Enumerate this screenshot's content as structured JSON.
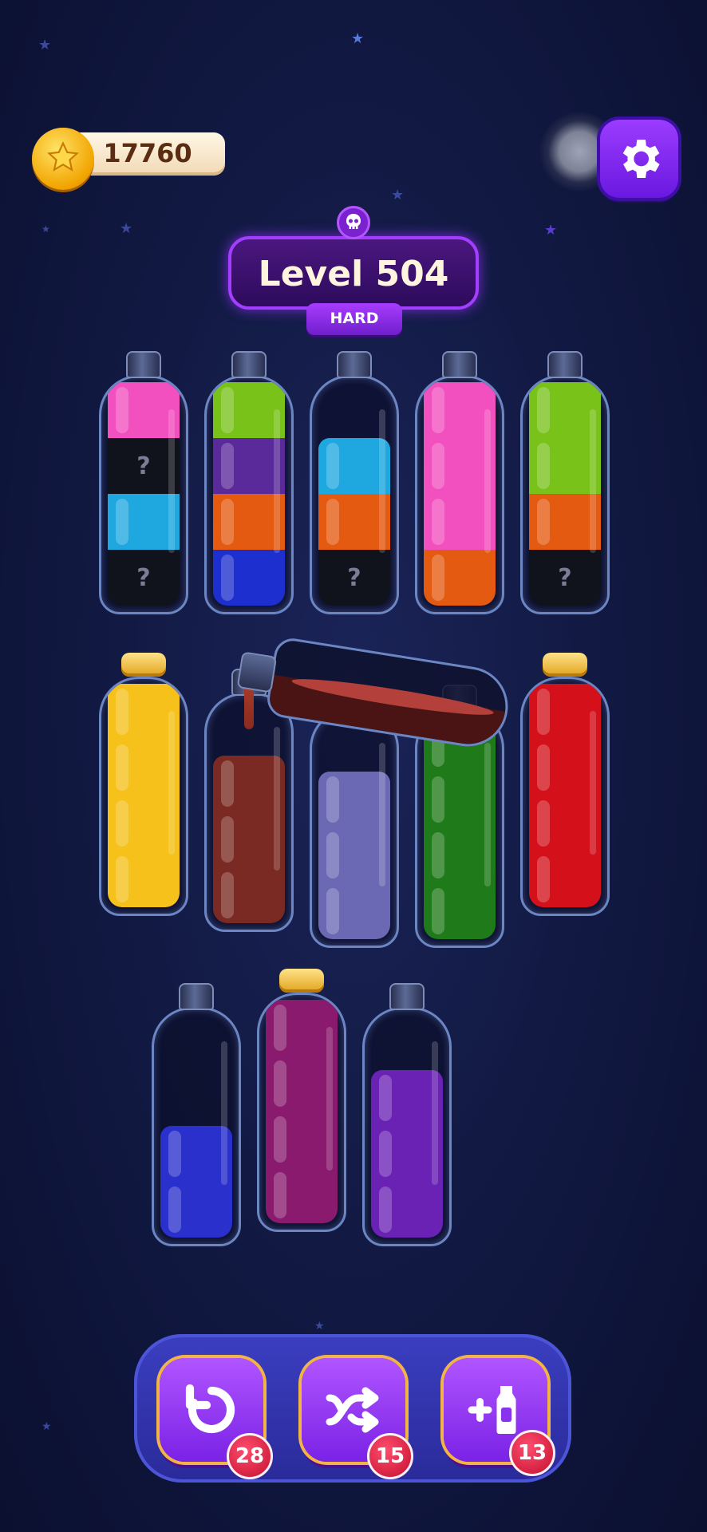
{
  "coins": {
    "value": "17760",
    "icon": "star-coin-icon"
  },
  "settings": {
    "icon": "gear-icon"
  },
  "level": {
    "title": "Level 504",
    "difficulty": "HARD",
    "icon": "skull-icon"
  },
  "colors": {
    "pink": "#f24fbf",
    "green": "#78c21a",
    "purple": "#5a2a9a",
    "orange": "#e45a10",
    "blue": "#1e2fd0",
    "cyan": "#1fa8e0",
    "black": "#10121c",
    "yellow": "#f5c11a",
    "brown": "#7a2a22",
    "lavender": "#6c69b4",
    "darkgreen": "#1f7a1a",
    "red": "#d4111a",
    "royalblue": "#2a30cc",
    "magenta": "#8a1a6e",
    "violet": "#6a22b4"
  },
  "bottles": [
    {
      "id": "b1",
      "corked": false,
      "layers": [
        {
          "color": "black",
          "hidden": true
        },
        {
          "color": "cyan"
        },
        {
          "color": "black",
          "hidden": true
        },
        {
          "color": "pink"
        }
      ]
    },
    {
      "id": "b2",
      "corked": false,
      "layers": [
        {
          "color": "blue"
        },
        {
          "color": "orange"
        },
        {
          "color": "purple"
        },
        {
          "color": "green"
        }
      ]
    },
    {
      "id": "b3",
      "corked": false,
      "layers": [
        {
          "color": "black",
          "hidden": true
        },
        {
          "color": "orange"
        },
        {
          "color": "cyan"
        }
      ]
    },
    {
      "id": "b4",
      "corked": false,
      "layers": [
        {
          "color": "orange"
        },
        {
          "color": "pink"
        },
        {
          "color": "pink"
        },
        {
          "color": "pink"
        }
      ]
    },
    {
      "id": "b5",
      "corked": false,
      "layers": [
        {
          "color": "black",
          "hidden": true
        },
        {
          "color": "orange"
        },
        {
          "color": "green"
        },
        {
          "color": "green"
        }
      ]
    },
    {
      "id": "b6",
      "corked": true,
      "layers": [
        {
          "color": "yellow"
        },
        {
          "color": "yellow"
        },
        {
          "color": "yellow"
        },
        {
          "color": "yellow"
        }
      ]
    },
    {
      "id": "b7",
      "corked": false,
      "layers": [
        {
          "color": "brown"
        },
        {
          "color": "brown"
        },
        {
          "color": "brown"
        }
      ]
    },
    {
      "id": "b8",
      "corked": false,
      "layers": [
        {
          "color": "lavender"
        },
        {
          "color": "lavender"
        },
        {
          "color": "lavender"
        }
      ]
    },
    {
      "id": "b9",
      "corked": false,
      "layers": [
        {
          "color": "darkgreen"
        },
        {
          "color": "darkgreen"
        },
        {
          "color": "darkgreen"
        },
        {
          "color": "darkgreen"
        }
      ]
    },
    {
      "id": "b10",
      "corked": true,
      "layers": [
        {
          "color": "red"
        },
        {
          "color": "red"
        },
        {
          "color": "red"
        },
        {
          "color": "red"
        }
      ]
    },
    {
      "id": "b11",
      "corked": false,
      "layers": [
        {
          "color": "royalblue"
        },
        {
          "color": "royalblue"
        }
      ]
    },
    {
      "id": "b12",
      "corked": true,
      "layers": [
        {
          "color": "magenta"
        },
        {
          "color": "magenta"
        },
        {
          "color": "magenta"
        },
        {
          "color": "magenta"
        }
      ]
    },
    {
      "id": "b13",
      "corked": false,
      "layers": [
        {
          "color": "violet"
        },
        {
          "color": "violet"
        },
        {
          "color": "violet"
        }
      ]
    }
  ],
  "hidden_marker": "?",
  "pouring_color": "brown",
  "tools": {
    "undo": {
      "icon": "undo-icon",
      "count": "28"
    },
    "shuffle": {
      "icon": "shuffle-icon",
      "count": "15"
    },
    "add_bottle": {
      "icon": "add-bottle-icon",
      "count": "13"
    }
  }
}
